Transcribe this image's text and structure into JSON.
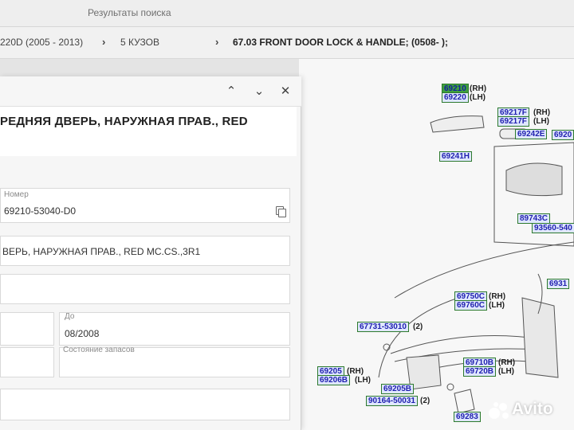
{
  "search_bar": {
    "results_label": "Результаты поиска"
  },
  "breadcrumb": {
    "items": [
      "220D (2005 - 2013)",
      "5 КУЗОВ",
      "67.03 FRONT DOOR LOCK & HANDLE; (0508- );"
    ]
  },
  "dialog": {
    "title": "РЕДНЯЯ ДВЕРЬ, НАРУЖНАЯ ПРАВ., RED",
    "number_label": "Номер",
    "number_value": "69210-53040-D0",
    "description": "ВЕРЬ, НАРУЖНАЯ ПРАВ., RED MC.CS.,3R1",
    "to_label": "До",
    "to_value": "08/2008",
    "stock_label": "Состояние запасов"
  },
  "diagram": {
    "codes": [
      {
        "code": "69210",
        "side": "(RH)"
      },
      {
        "code": "69220",
        "side": "(LH)"
      },
      {
        "code": "69217F",
        "side": "(RH)"
      },
      {
        "code": "69217F",
        "side": "(LH)"
      },
      {
        "code": "69242E",
        "side": ""
      },
      {
        "code": "69241H",
        "side": ""
      },
      {
        "code": "89743C",
        "side": ""
      },
      {
        "code": "93560-540",
        "side": ""
      },
      {
        "code": "69750C",
        "side": "(RH)"
      },
      {
        "code": "69760C",
        "side": "(LH)"
      },
      {
        "code": "67731-53010",
        "side": "(2)"
      },
      {
        "code": "69710B",
        "side": "(RH)"
      },
      {
        "code": "69720B",
        "side": "(LH)"
      },
      {
        "code": "69205",
        "side": "(RH)"
      },
      {
        "code": "69206B",
        "side": "(LH)"
      },
      {
        "code": "69205B",
        "side": ""
      },
      {
        "code": "90164-50031",
        "side": "(2)"
      },
      {
        "code": "69283",
        "side": ""
      },
      {
        "code": "6931",
        "side": ""
      },
      {
        "code": "6920",
        "side": ""
      }
    ]
  },
  "watermark": {
    "text": "Avito"
  }
}
